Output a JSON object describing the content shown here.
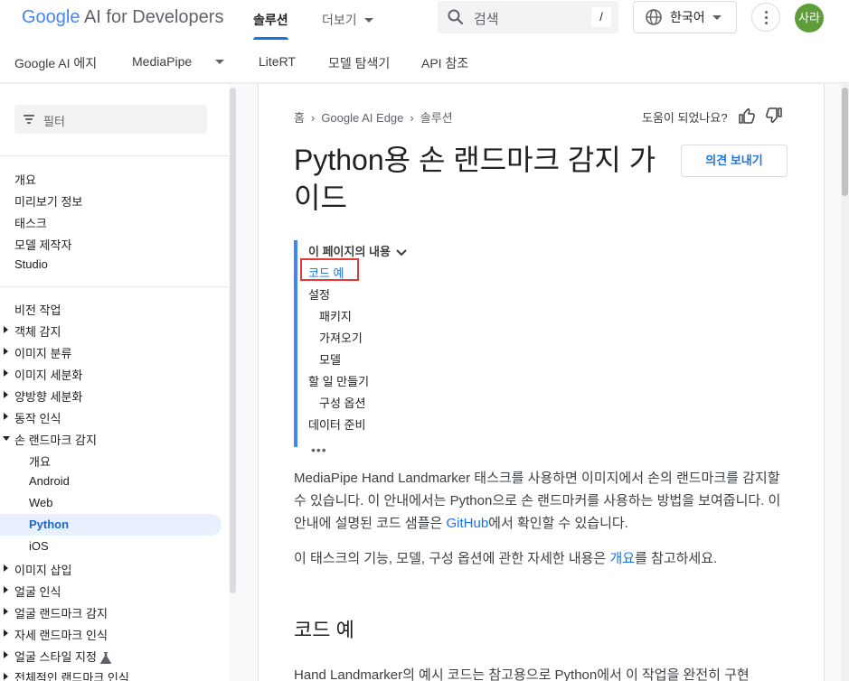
{
  "header": {
    "logo_google": "Google",
    "logo_rest": " AI for Developers",
    "nav": [
      {
        "label": "솔루션"
      },
      {
        "label": "더보기"
      }
    ],
    "search_placeholder": "검색",
    "search_shortcut": "/",
    "language": "한국어",
    "avatar_initials": "사라"
  },
  "subnav": {
    "items": [
      {
        "label": "Google AI 에지"
      },
      {
        "label": "MediaPipe"
      },
      {
        "label": "LiteRT"
      },
      {
        "label": "모델 탐색기"
      },
      {
        "label": "API 참조"
      }
    ]
  },
  "sidebar": {
    "filter_label": "필터",
    "group1": [
      {
        "label": "개요"
      },
      {
        "label": "미리보기 정보"
      },
      {
        "label": "태스크"
      },
      {
        "label": "모델 제작자"
      },
      {
        "label": "Studio"
      }
    ],
    "section_title": "비전 작업",
    "group2": [
      {
        "label": "객체 감지"
      },
      {
        "label": "이미지 분류"
      },
      {
        "label": "이미지 세분화"
      },
      {
        "label": "양방향 세분화"
      },
      {
        "label": "동작 인식"
      },
      {
        "label": "손 랜드마크 감지"
      }
    ],
    "hand_children": [
      {
        "label": "개요"
      },
      {
        "label": "Android"
      },
      {
        "label": "Web"
      },
      {
        "label": "Python"
      },
      {
        "label": "iOS"
      }
    ],
    "group3": [
      {
        "label": "이미지 삽입"
      },
      {
        "label": "얼굴 인식"
      },
      {
        "label": "얼굴 랜드마크 감지"
      },
      {
        "label": "자세 랜드마크 인식"
      },
      {
        "label": "얼굴 스타일 지정"
      },
      {
        "label": "전체적인 랜드마크 인식"
      }
    ]
  },
  "content": {
    "breadcrumbs": [
      {
        "label": "홈"
      },
      {
        "label": "Google AI Edge"
      },
      {
        "label": "솔루션"
      }
    ],
    "helpful": "도움이 되었나요?",
    "title_line1": "Python용 손 랜드마크 감지 가",
    "title_line2": "이드",
    "feedback": "의견 보내기",
    "toc": {
      "heading": "이 페이지의 내용",
      "items": [
        {
          "label": "코드 예"
        },
        {
          "label": "설정"
        },
        {
          "label": "패키지"
        },
        {
          "label": "가져오기"
        },
        {
          "label": "모델"
        },
        {
          "label": "할 일 만들기"
        },
        {
          "label": "구성 옵션"
        },
        {
          "label": "데이터 준비"
        }
      ],
      "more": "•••"
    },
    "p1_a": "MediaPipe Hand Landmarker 태스크를 사용하면 이미지에서 손의 랜드마크를 감지할 수 있습니다. 이 안내에서는 Python으로 손 랜드마커를 사용하는 방법을 보여줍니다. 이 안내에 설명된 코드 샘플은 ",
    "p1_link": "GitHub",
    "p1_b": "에서 확인할 수 있습니다.",
    "p2_a": "이 태스크의 기능, 모델, 구성 옵션에 관한 자세한 내용은 ",
    "p2_link": "개요",
    "p2_b": "를 참고하세요.",
    "h2": "코드 예",
    "p3": "Hand Landmarker의 예시 코드는 참고용으로 Python에서 이 작업을 완전히 구현"
  },
  "colors": {
    "accent": "#1a73e8",
    "highlight_box": "#e53935",
    "avatar": "#5e9e3a"
  }
}
